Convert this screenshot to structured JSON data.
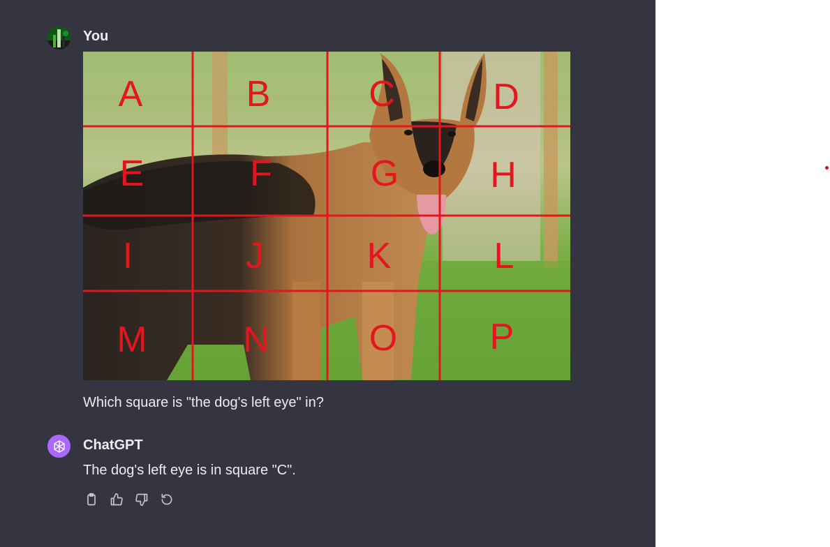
{
  "messages": [
    {
      "author": "You",
      "text": "Which square is \"the dog's left eye\" in?",
      "image": {
        "grid_labels": [
          "A",
          "B",
          "C",
          "D",
          "E",
          "F",
          "G",
          "H",
          "I",
          "J",
          "K",
          "L",
          "M",
          "N",
          "O",
          "P"
        ],
        "subject": "German Shepherd dog on grass"
      }
    },
    {
      "author": "ChatGPT",
      "text": "The dog's left eye is in square \"C\"."
    }
  ],
  "actions": [
    {
      "icon": "clipboard-icon",
      "label": "Copy"
    },
    {
      "icon": "thumbs-up-icon",
      "label": "Good response"
    },
    {
      "icon": "thumbs-down-icon",
      "label": "Bad response"
    },
    {
      "icon": "regenerate-icon",
      "label": "Regenerate"
    }
  ],
  "colors": {
    "chat_background": "#343541",
    "text": "#ececf1",
    "grid_red": "#e3161f",
    "gpt_avatar": "#ab68ff",
    "icon_gray": "#c5c5d2"
  }
}
